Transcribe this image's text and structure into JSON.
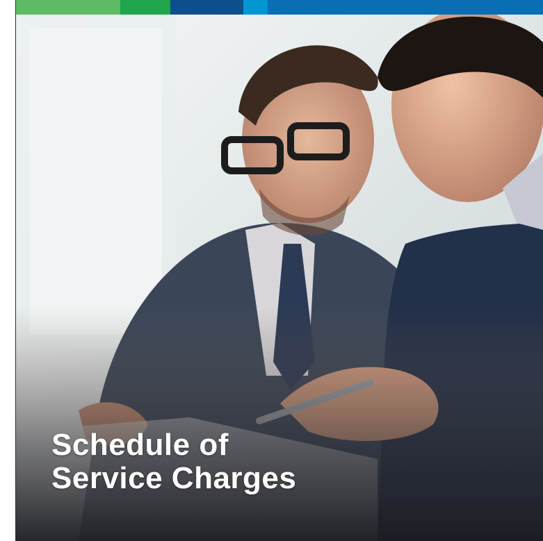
{
  "title": {
    "line1": "Schedule of",
    "line2": "Service Charges"
  },
  "colors": {
    "bar": [
      "#5dbb63",
      "#1fa54c",
      "#0d4f8b",
      "#0096d6",
      "#0a6eb4"
    ]
  },
  "photo": {
    "icon": "business-meeting-photo"
  }
}
